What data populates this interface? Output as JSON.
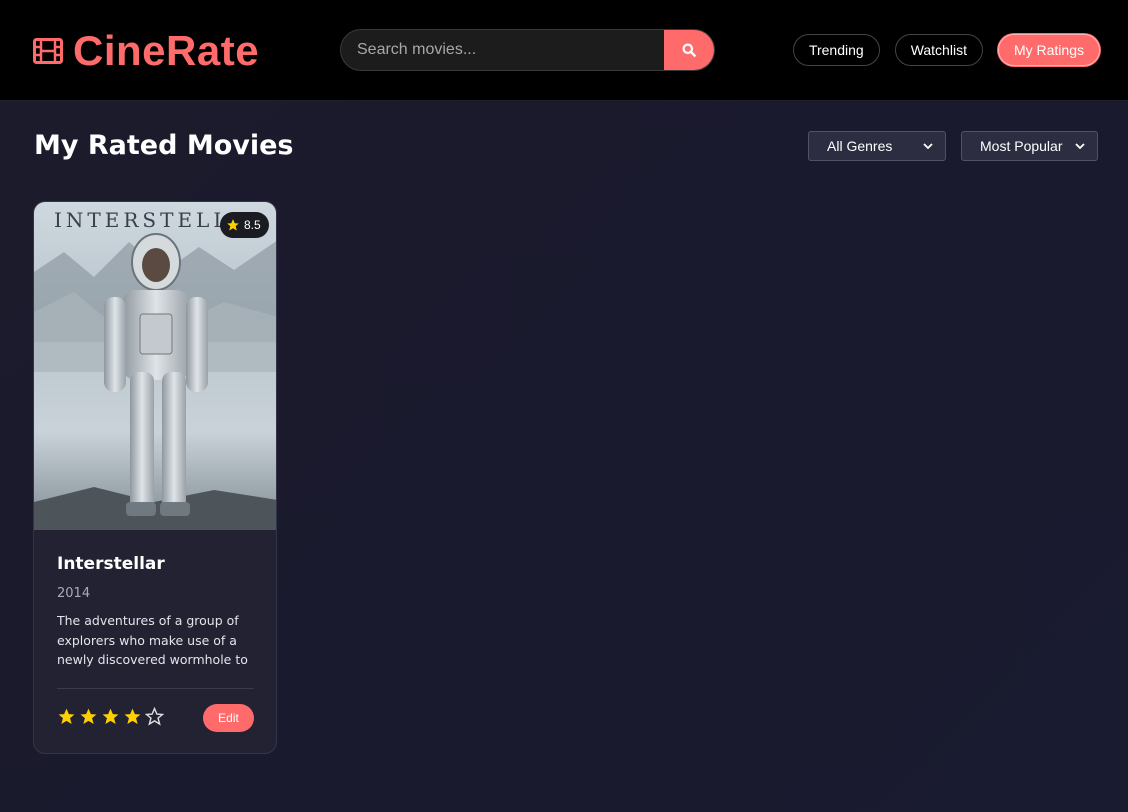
{
  "app": {
    "name": "CineRate",
    "brand_color": "#ff6b6b"
  },
  "header": {
    "search": {
      "placeholder": "Search movies..."
    },
    "nav": [
      {
        "label": "Trending",
        "active": false
      },
      {
        "label": "Watchlist",
        "active": false
      },
      {
        "label": "My Ratings",
        "active": true
      }
    ]
  },
  "page": {
    "title": "My Rated Movies",
    "filters": {
      "genre": {
        "selected": "All Genres"
      },
      "sort": {
        "selected": "Most Popular"
      }
    }
  },
  "movies": [
    {
      "poster_title": "INTERSTELLAR",
      "rating": "8.5",
      "title": "Interstellar",
      "year": "2014",
      "description": "The adventures of a group of explorers who make use of a newly discovered wormhole to surpass...",
      "user_stars": 4,
      "max_stars": 5,
      "edit_label": "Edit"
    }
  ]
}
